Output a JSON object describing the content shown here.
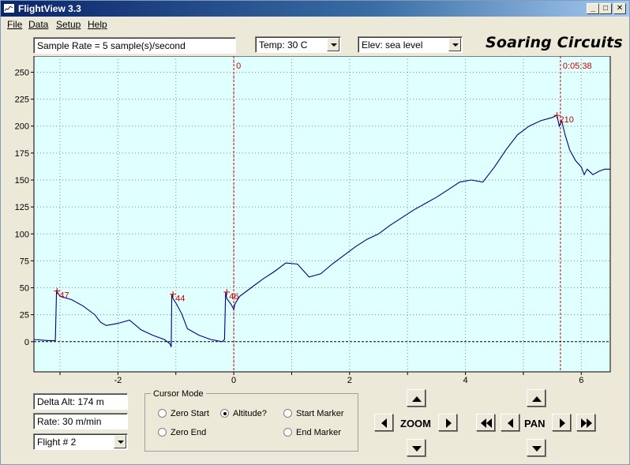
{
  "window": {
    "title": "FlightView 3.3",
    "minimize": "_",
    "maximize": "□",
    "close": "✕"
  },
  "menu": [
    "File",
    "Data",
    "Setup",
    "Help"
  ],
  "toolbar": {
    "sample_rate": "Sample Rate =  5 sample(s)/second",
    "temp": "Temp:  30 C",
    "elev": "Elev: sea level",
    "brand": "Soaring Circuits"
  },
  "chart_data": {
    "type": "line",
    "xlim": [
      -3.45,
      6.5
    ],
    "ylim": [
      -28,
      265
    ],
    "yticks": [
      0,
      25,
      50,
      75,
      100,
      125,
      150,
      175,
      200,
      225,
      250
    ],
    "xticks": [
      -2,
      0,
      2,
      4,
      6
    ],
    "grid": true,
    "baseline": 0,
    "markers": [
      {
        "x": 0,
        "label": "0"
      },
      {
        "x": 5.64,
        "label": "0:05:38"
      }
    ],
    "peaks": [
      {
        "x": -3.05,
        "y": 47,
        "label": "47"
      },
      {
        "x": -1.05,
        "y": 44,
        "label": "44"
      },
      {
        "x": -0.12,
        "y": 46,
        "label": "46"
      },
      {
        "x": 5.58,
        "y": 210,
        "label": "210"
      }
    ],
    "series": [
      {
        "color": "#000080",
        "x": [
          -3.45,
          -3.2,
          -3.08,
          -3.06,
          -3.0,
          -2.8,
          -2.6,
          -2.4,
          -2.3,
          -2.2,
          -2.1,
          -2.0,
          -1.8,
          -1.6,
          -1.4,
          -1.2,
          -1.1,
          -1.08,
          -1.07,
          -1.05,
          -1.0,
          -0.9,
          -0.8,
          -0.6,
          -0.4,
          -0.2,
          -0.16,
          -0.14,
          -0.12,
          -0.05,
          0.0,
          0.02,
          0.1,
          0.3,
          0.5,
          0.7,
          0.9,
          1.1,
          1.3,
          1.5,
          1.7,
          1.9,
          2.1,
          2.3,
          2.5,
          2.7,
          2.9,
          3.1,
          3.3,
          3.5,
          3.7,
          3.9,
          4.1,
          4.3,
          4.5,
          4.7,
          4.9,
          5.1,
          5.3,
          5.5,
          5.58,
          5.62,
          5.66,
          5.72,
          5.8,
          5.9,
          6.0,
          6.05,
          6.1,
          6.2,
          6.3,
          6.4,
          6.5
        ],
        "y": [
          2,
          1,
          1,
          47,
          42,
          39,
          33,
          25,
          18,
          15,
          16,
          17,
          20,
          11,
          6,
          2,
          -2,
          -5,
          44,
          40,
          36,
          26,
          12,
          6,
          2,
          0,
          2,
          46,
          40,
          35,
          30,
          35,
          42,
          50,
          58,
          65,
          73,
          72,
          60,
          63,
          72,
          80,
          88,
          95,
          100,
          108,
          115,
          122,
          128,
          134,
          141,
          148,
          150,
          148,
          162,
          178,
          192,
          200,
          205,
          208,
          210,
          200,
          205,
          192,
          178,
          168,
          162,
          155,
          160,
          155,
          158,
          160,
          160
        ]
      }
    ]
  },
  "bottom": {
    "delta_alt": "Delta Alt: 174 m",
    "rate": "Rate: 30 m/min",
    "flight": "Flight # 2",
    "cursor_mode": {
      "title": "Cursor Mode",
      "options": [
        "Zero Start",
        "Altitude?",
        "Start Marker",
        "Zero End",
        "End Marker"
      ],
      "selected": "Altitude?"
    },
    "zoom_label": "ZOOM",
    "pan_label": "PAN"
  }
}
